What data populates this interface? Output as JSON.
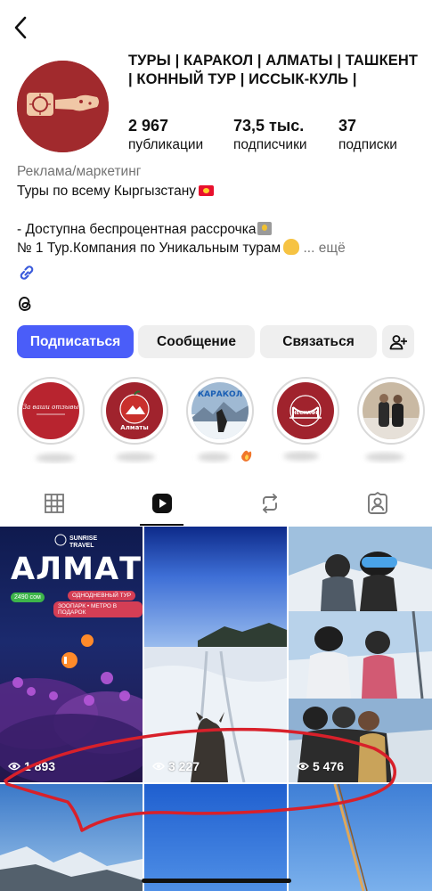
{
  "profile": {
    "name": "ТУРЫ | КАРАКОЛ | АЛМАТЫ | ТАШКЕНТ | КОННЫЙ ТУР | ИССЫК-КУЛЬ |",
    "stats": [
      {
        "value": "2 967",
        "label": "публикации"
      },
      {
        "value": "73,5 тыс.",
        "label": "подписчики"
      },
      {
        "value": "37",
        "label": "подписки"
      }
    ],
    "category": "Реклама/маркетинг",
    "bio_line1": "Туры по всему Кыргызстану",
    "bio_line2": "- Доступна беспроцентная рассрочка",
    "bio_line3": "№ 1 Тур.Компания по Уникальным турам",
    "more": "... ещё",
    "accent_color": "#4a5df9",
    "avatar_color": "#a12a2d"
  },
  "icons": {
    "back": "chevron-left-icon",
    "link": "link-icon",
    "threads": "threads-icon",
    "add_user": "add-user-icon",
    "grid": "grid-icon",
    "reels": "reels-icon",
    "reposts": "repost-icon",
    "tagged": "tagged-icon",
    "views": "eye-icon"
  },
  "actions": {
    "follow": "Подписаться",
    "message": "Сообщение",
    "contact": "Связаться"
  },
  "highlights": [
    {
      "label": ""
    },
    {
      "label": ""
    },
    {
      "label": ""
    },
    {
      "label": ""
    },
    {
      "label": ""
    }
  ],
  "highlight_texts": {
    "h1": "За ваши отзывы",
    "h2": "Алматы",
    "h3": "КАРАКОЛ",
    "h4": "НЕСКАФЕ"
  },
  "reels": [
    {
      "views": "1 893",
      "title": "АЛМАТЫ",
      "brand": "SUNRISE TRAVEL",
      "price": "2490 сом",
      "tag1": "ОДНОДНЕВНЫЙ ТУР",
      "tag2": "ЗООПАРК • МЕТРО В ПОДАРОК"
    },
    {
      "views": "3 227"
    },
    {
      "views": "5 476"
    }
  ]
}
